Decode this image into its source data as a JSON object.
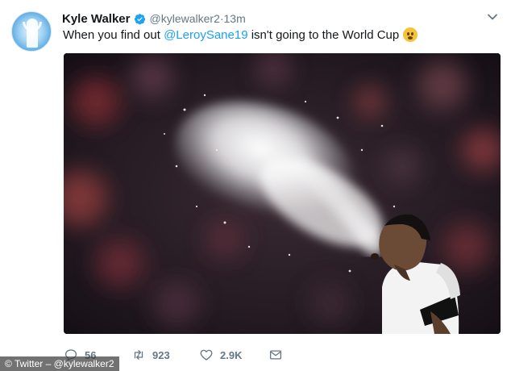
{
  "tweet": {
    "author_name": "Kyle Walker",
    "handle": "@kylewalker2",
    "time": " ·13m",
    "text_before": "When you find out ",
    "mention": "@LeroySane19",
    "text_after": " isn't going to the World Cup",
    "emoji": "worried-face-emoji"
  },
  "actions": {
    "replies": "56",
    "retweets": "923",
    "likes": "2.9K"
  },
  "watermark": "© Twitter – @kylewalker2",
  "colors": {
    "link": "#1da1f2",
    "muted": "#657786",
    "text": "#14171a",
    "verified": "#1da1f2"
  }
}
